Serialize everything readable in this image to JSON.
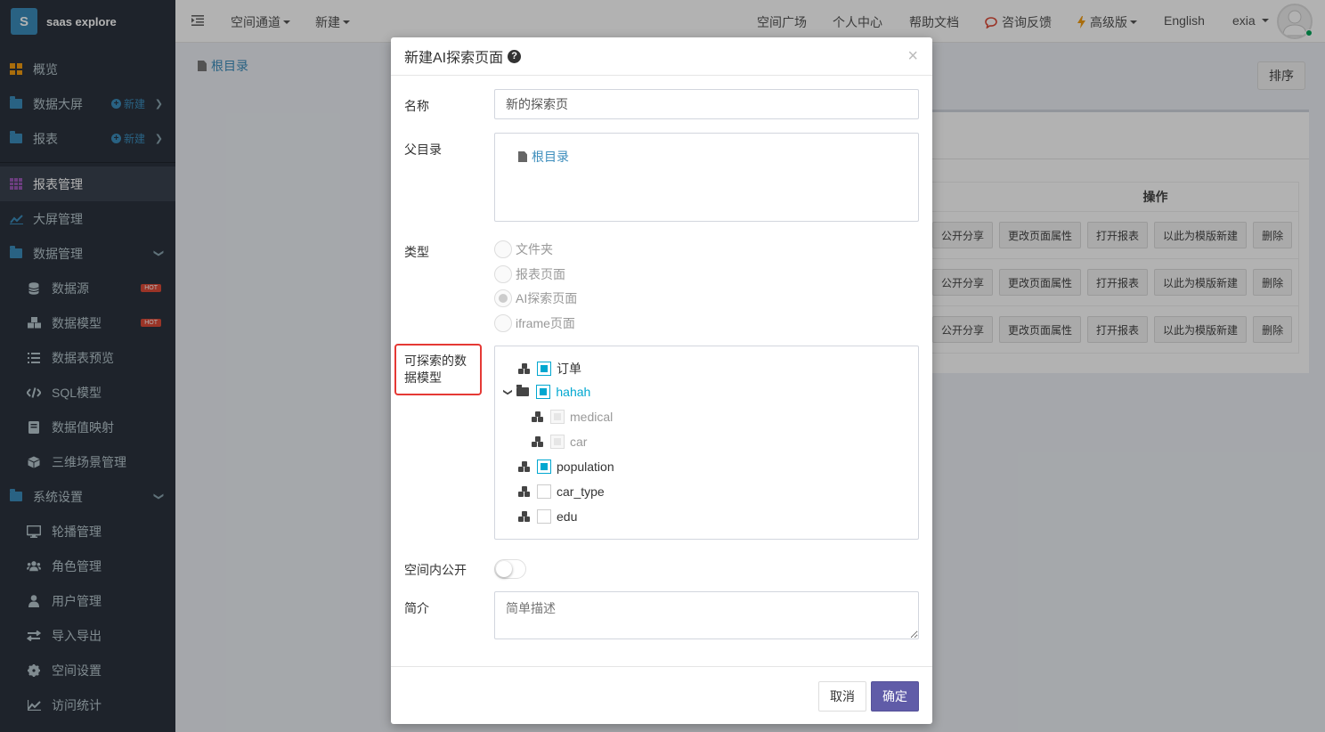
{
  "app": {
    "logo_letter": "S",
    "name": "saas explore"
  },
  "sidebar": {
    "items": [
      {
        "label": "概览"
      },
      {
        "label": "数据大屏",
        "new": "新建"
      },
      {
        "label": "报表",
        "new": "新建"
      },
      {
        "label": "报表管理"
      },
      {
        "label": "大屏管理"
      },
      {
        "label": "数据管理"
      },
      {
        "label": "数据源",
        "badge": "HOT"
      },
      {
        "label": "数据模型",
        "badge": "HOT"
      },
      {
        "label": "数据表预览"
      },
      {
        "label": "SQL模型"
      },
      {
        "label": "数据值映射"
      },
      {
        "label": "三维场景管理"
      },
      {
        "label": "系统设置"
      },
      {
        "label": "轮播管理"
      },
      {
        "label": "角色管理"
      },
      {
        "label": "用户管理"
      },
      {
        "label": "导入导出"
      },
      {
        "label": "空间设置"
      },
      {
        "label": "访问统计"
      }
    ]
  },
  "topbar": {
    "space_channel": "空间通道",
    "new": "新建",
    "space_square": "空间广场",
    "personal_center": "个人中心",
    "help_docs": "帮助文档",
    "feedback": "咨询反馈",
    "advanced": "高级版",
    "language": "English",
    "user": "exia"
  },
  "content": {
    "breadcrumb": "根目录",
    "sort_button": "排序",
    "table_header_ops": "操作",
    "row_ops": [
      "公开分享",
      "更改页面属性",
      "打开报表",
      "以此为模版新建",
      "删除"
    ]
  },
  "modal": {
    "title": "新建AI探索页面",
    "close": "×",
    "name_label": "名称",
    "name_value": "新的探索页",
    "parent_label": "父目录",
    "parent_value": "根目录",
    "type_label": "类型",
    "type_options": [
      "文件夹",
      "报表页面",
      "AI探索页面",
      "iframe页面"
    ],
    "type_selected": "AI探索页面",
    "models_label": "可探索的数据模型",
    "models_label_line1": "可探索的数",
    "models_label_line2": "据模型",
    "tree": {
      "order": "订单",
      "hahah": "hahah",
      "medical": "medical",
      "car": "car",
      "population": "population",
      "car_type": "car_type",
      "edu": "edu"
    },
    "public_label": "空间内公开",
    "desc_label": "简介",
    "desc_placeholder": "简单描述",
    "cancel": "取消",
    "confirm": "确定"
  },
  "colors": {
    "accent": "#605ca8",
    "link": "#3c8dbc",
    "tree_check": "#00a7d0",
    "highlight": "#e53935"
  }
}
